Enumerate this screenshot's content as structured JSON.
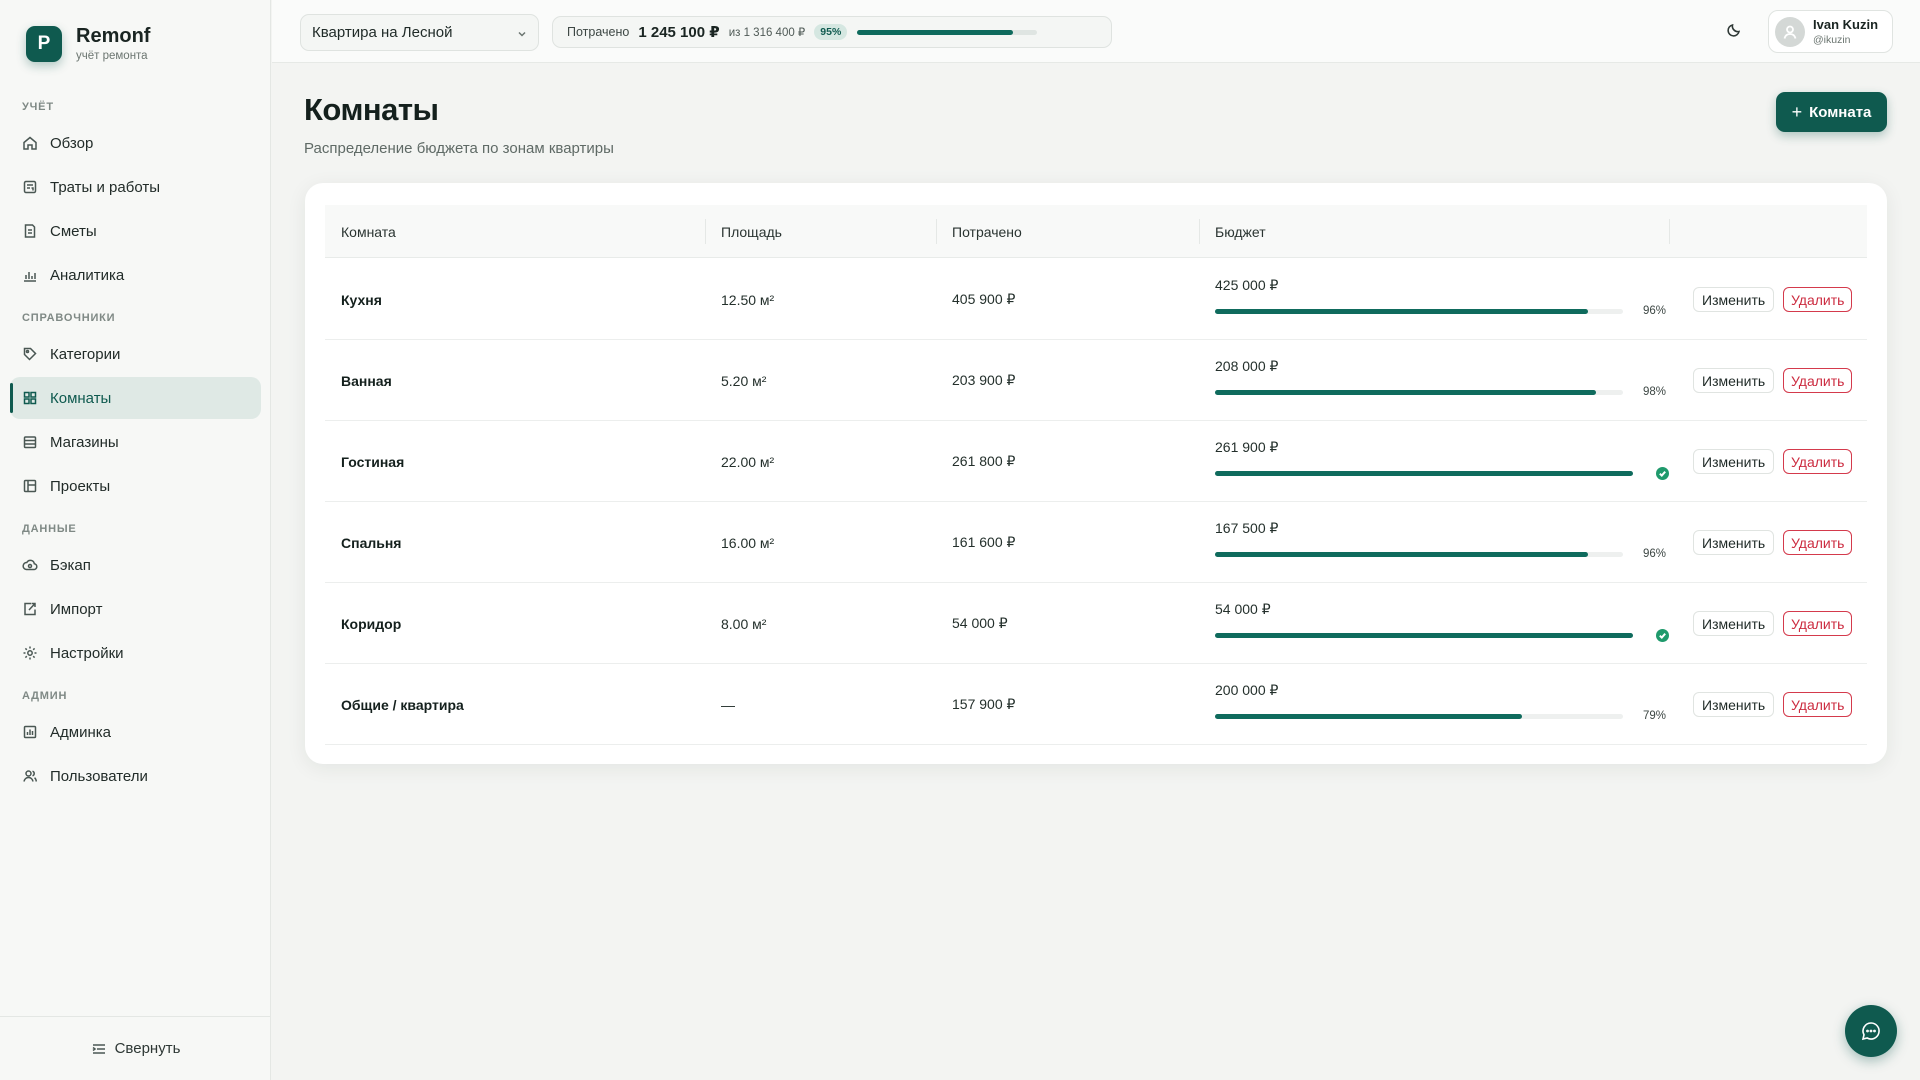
{
  "brand": {
    "logo_letter": "P",
    "name": "Remonf",
    "subtitle": "учёт ремонта"
  },
  "sidebar": {
    "sections": [
      {
        "title": "УЧЁТ"
      },
      {
        "title": "СПРАВОЧНИКИ"
      },
      {
        "title": "ДАННЫЕ"
      },
      {
        "title": "АДМИН"
      }
    ],
    "items": [
      {
        "label": "Обзор",
        "icon": "home-icon"
      },
      {
        "label": "Траты и работы",
        "icon": "receipt-icon"
      },
      {
        "label": "Сметы",
        "icon": "estimate-icon"
      },
      {
        "label": "Аналитика",
        "icon": "chart-icon"
      },
      {
        "label": "Категории",
        "icon": "tag-icon"
      },
      {
        "label": "Комнаты",
        "icon": "grid-icon",
        "active": true
      },
      {
        "label": "Магазины",
        "icon": "store-icon"
      },
      {
        "label": "Проекты",
        "icon": "project-icon"
      },
      {
        "label": "Бэкап",
        "icon": "backup-icon"
      },
      {
        "label": "Импорт",
        "icon": "import-icon"
      },
      {
        "label": "Настройки",
        "icon": "gear-icon"
      },
      {
        "label": "Админка",
        "icon": "admin-icon"
      },
      {
        "label": "Пользователи",
        "icon": "users-icon"
      }
    ],
    "collapse_label": "Свернуть"
  },
  "topbar": {
    "project": "Квартира на Лесной",
    "spent_label": "Потрачено",
    "spent_value": "1 245 100 ₽",
    "spent_of": "из 1 316 400 ₽",
    "spent_percent_label": "95%",
    "spent_fraction": 0.95,
    "user_name": "Ivan Kuzin",
    "user_login": "@ikuzin"
  },
  "page": {
    "title": "Комнаты",
    "subtitle": "Распределение бюджета по зонам квартиры",
    "add_button": "Комната"
  },
  "table": {
    "columns": [
      "Комната",
      "Площадь",
      "Потрачено",
      "Бюджет"
    ],
    "edit_label": "Изменить",
    "delete_label": "Удалить",
    "rows": [
      {
        "name": "Кухня",
        "area": "12.50 м²",
        "spent": "405 900 ₽",
        "budget": "425 000 ₽",
        "percent_label": "96%",
        "fraction": 0.96,
        "complete": false
      },
      {
        "name": "Ванная",
        "area": "5.20 м²",
        "spent": "203 900 ₽",
        "budget": "208 000 ₽",
        "percent_label": "98%",
        "fraction": 0.98,
        "complete": false
      },
      {
        "name": "Гостиная",
        "area": "22.00 м²",
        "spent": "261 800 ₽",
        "budget": "261 900 ₽",
        "percent_label": "",
        "fraction": 1.0,
        "complete": true
      },
      {
        "name": "Спальня",
        "area": "16.00 м²",
        "spent": "161 600 ₽",
        "budget": "167 500 ₽",
        "percent_label": "96%",
        "fraction": 0.96,
        "complete": false
      },
      {
        "name": "Коридор",
        "area": "8.00 м²",
        "spent": "54 000 ₽",
        "budget": "54 000 ₽",
        "percent_label": "",
        "fraction": 1.0,
        "complete": true
      },
      {
        "name": "Общие / квартира",
        "area": "—",
        "spent": "157 900 ₽",
        "budget": "200 000 ₽",
        "percent_label": "79%",
        "fraction": 0.79,
        "complete": false
      }
    ]
  },
  "colors": {
    "accent": "#0f5a4f",
    "danger": "#cc2c40",
    "success": "#1f9a6c"
  }
}
